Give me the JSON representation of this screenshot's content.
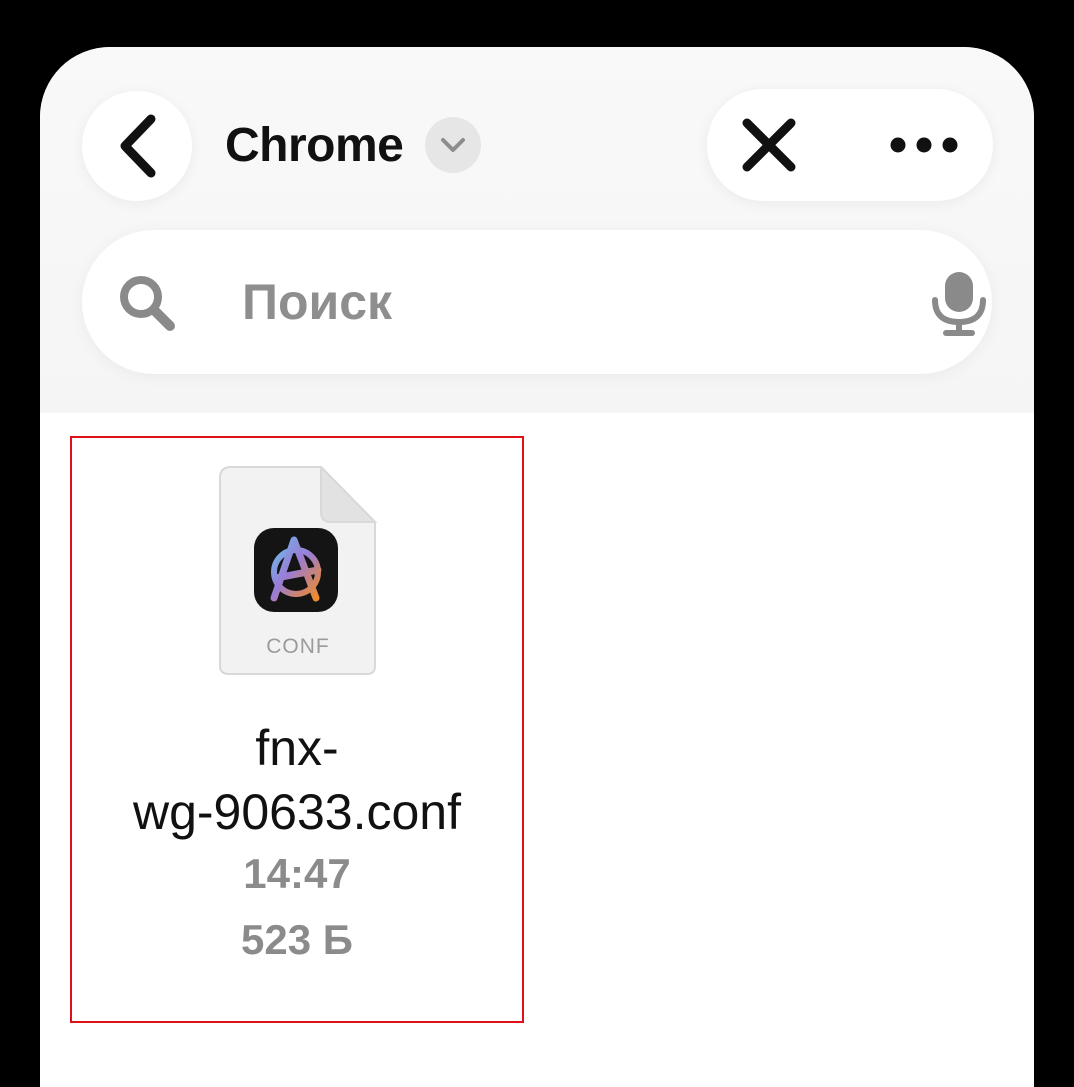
{
  "header": {
    "title": "Chrome"
  },
  "search": {
    "placeholder": "Поиск"
  },
  "files": [
    {
      "name": "fnx-wg-90633.conf",
      "name_line1": "fnx-",
      "name_line2": "wg-90633.conf",
      "type_label": "CONF",
      "time": "14:47",
      "size": "523 Б",
      "icon": "anarchy-app-icon"
    }
  ],
  "icons": {
    "back": "chevron-left-icon",
    "title_menu": "chevron-down-icon",
    "close": "close-icon",
    "more": "ellipsis-icon",
    "search": "search-icon",
    "mic": "microphone-icon"
  },
  "colors": {
    "selection_border": "#e0101a",
    "secondary_text": "#8b8b8b"
  }
}
